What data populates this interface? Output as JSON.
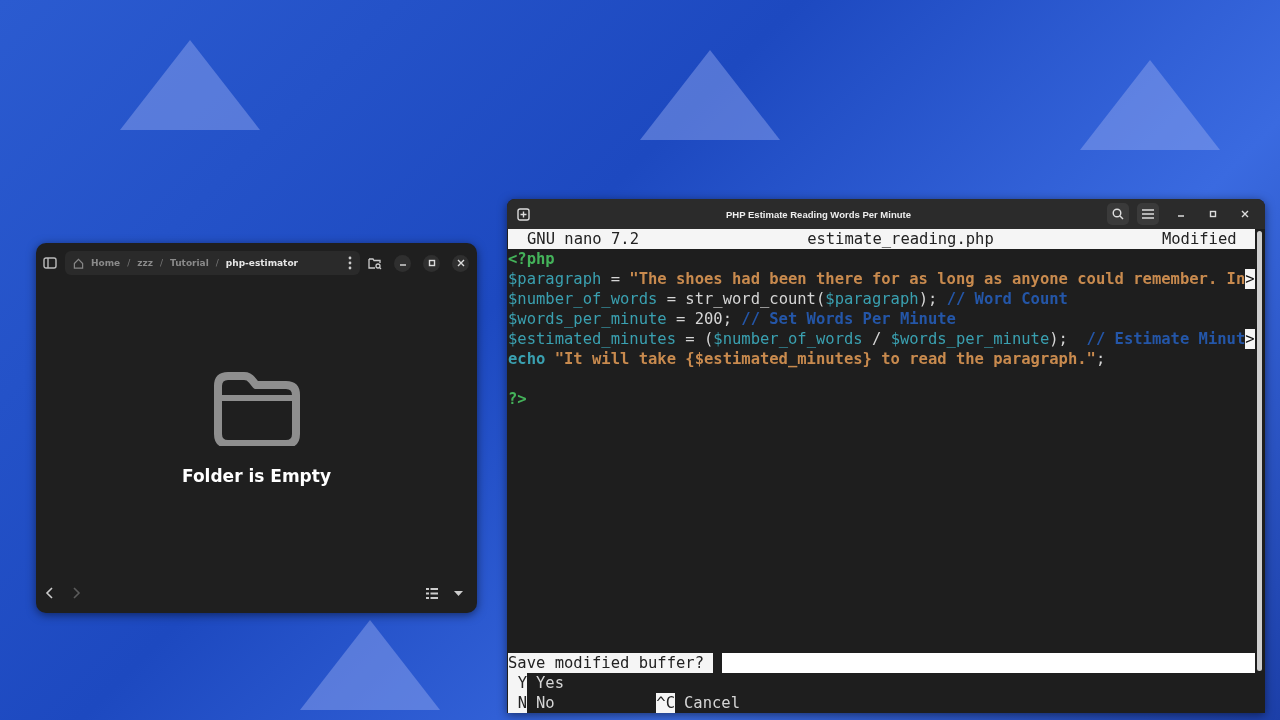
{
  "file_manager": {
    "breadcrumbs": [
      {
        "label": "Home",
        "separator": "/",
        "selected": false,
        "kind": "home"
      },
      {
        "label": "zzz",
        "separator": "/",
        "selected": false,
        "kind": "folder"
      },
      {
        "label": "Tutorial",
        "separator": "/",
        "selected": false,
        "kind": "folder"
      },
      {
        "label": "php-estimator",
        "selected": true,
        "kind": "folder"
      }
    ],
    "empty_message": "Folder is Empty",
    "forward_disabled": true
  },
  "terminal": {
    "title": "PHP Estimate Reading Words Per Minute",
    "header": {
      "version": "GNU nano 7.2",
      "filename": "estimate_reading.php",
      "status": "Modified"
    },
    "lines": [
      {
        "kind": "code",
        "tokens": [
          {
            "kind": "tag",
            "text": "<?php"
          }
        ]
      },
      {
        "kind": "code",
        "tokens": [
          {
            "kind": "var",
            "text": "$paragraph"
          },
          {
            "kind": "plain",
            "text": " = "
          },
          {
            "kind": "string",
            "text": "\"The shoes had been there for as long as anyone could remember. In"
          }
        ],
        "overflow_mark": ">"
      },
      {
        "kind": "code",
        "tokens": [
          {
            "kind": "var",
            "text": "$number_of_words"
          },
          {
            "kind": "plain",
            "text": " = str_word_count("
          },
          {
            "kind": "var",
            "text": "$paragraph"
          },
          {
            "kind": "plain",
            "text": "); "
          },
          {
            "kind": "comment",
            "text": "// Word Count"
          }
        ]
      },
      {
        "kind": "code",
        "tokens": [
          {
            "kind": "var",
            "text": "$words_per_minute"
          },
          {
            "kind": "plain",
            "text": " = 200; "
          },
          {
            "kind": "comment",
            "text": "// Set Words Per Minute"
          }
        ]
      },
      {
        "kind": "code",
        "tokens": [
          {
            "kind": "var",
            "text": "$estimated_minutes"
          },
          {
            "kind": "plain",
            "text": " = ("
          },
          {
            "kind": "var",
            "text": "$number_of_words"
          },
          {
            "kind": "plain",
            "text": " / "
          },
          {
            "kind": "var",
            "text": "$words_per_minute"
          },
          {
            "kind": "plain",
            "text": ");  "
          },
          {
            "kind": "comment",
            "text": "// Estimate Minut"
          }
        ],
        "overflow_mark": ">"
      },
      {
        "kind": "code",
        "tokens": [
          {
            "kind": "keyword",
            "text": "echo"
          },
          {
            "kind": "string",
            "text": " \"It will take {$estimated_minutes} to read the paragraph.\""
          },
          {
            "kind": "plain",
            "text": ";"
          }
        ]
      },
      {
        "kind": "blank"
      },
      {
        "kind": "code",
        "tokens": [
          {
            "kind": "tag",
            "text": "?>"
          }
        ]
      }
    ],
    "prompt": {
      "question": "Save modified buffer? "
    },
    "shortcut_rows": [
      [
        {
          "key": "Y",
          "label": "Yes"
        }
      ],
      [
        {
          "key": "N",
          "label": "No"
        },
        {
          "key": "^C",
          "label": "Cancel"
        }
      ]
    ]
  }
}
